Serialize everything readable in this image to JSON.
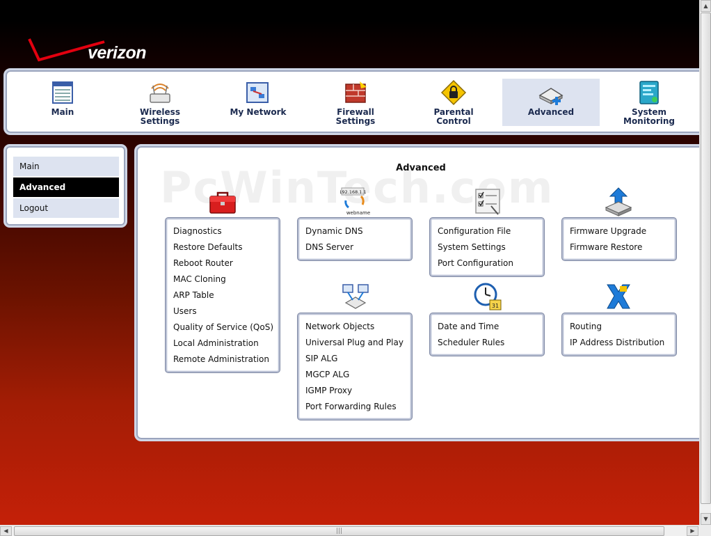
{
  "brand": {
    "name": "verizon"
  },
  "watermark": "PcWinTech.com",
  "topnav": [
    {
      "label": "Main",
      "icon": "main-table-icon"
    },
    {
      "label": "Wireless Settings",
      "icon": "wireless-router-icon"
    },
    {
      "label": "My Network",
      "icon": "my-network-icon"
    },
    {
      "label": "Firewall Settings",
      "icon": "firewall-icon"
    },
    {
      "label": "Parental Control",
      "icon": "parental-lock-icon"
    },
    {
      "label": "Advanced",
      "icon": "advanced-icon",
      "active": true
    },
    {
      "label": "System Monitoring",
      "icon": "system-monitoring-icon"
    }
  ],
  "sidebar": [
    {
      "label": "Main"
    },
    {
      "label": "Advanced",
      "active": true
    },
    {
      "label": "Logout"
    }
  ],
  "page_title": "Advanced",
  "groups": {
    "diagnostics": {
      "icon": "toolbox-icon",
      "items": [
        "Diagnostics",
        "Restore Defaults",
        "Reboot Router",
        "MAC Cloning",
        "ARP Table",
        "Users",
        "Quality of Service (QoS)",
        "Local Administration",
        "Remote Administration"
      ]
    },
    "dns": {
      "icon": "dns-icon",
      "icon_text": "192.168.1.1",
      "icon_sub": "webname",
      "items": [
        "Dynamic DNS",
        "DNS Server"
      ]
    },
    "configuration": {
      "icon": "configuration-checklist-icon",
      "items": [
        "Configuration File",
        "System Settings",
        "Port Configuration"
      ]
    },
    "firmware": {
      "icon": "firmware-upgrade-icon",
      "items": [
        "Firmware Upgrade",
        "Firmware Restore"
      ]
    },
    "network_objects": {
      "icon": "network-computers-icon",
      "items": [
        "Network Objects",
        "Universal Plug and Play",
        "SIP ALG",
        "MGCP ALG",
        "IGMP Proxy",
        "Port Forwarding Rules"
      ]
    },
    "date_time": {
      "icon": "clock-calendar-icon",
      "calendar_day": "31",
      "items": [
        "Date and Time",
        "Scheduler Rules"
      ]
    },
    "routing": {
      "icon": "routing-icon",
      "items": [
        "Routing",
        "IP Address Distribution"
      ]
    }
  },
  "colors": {
    "nav_text": "#1b2a4f",
    "active_tab": "#dde3f0",
    "active_sidebar": "#000000"
  }
}
